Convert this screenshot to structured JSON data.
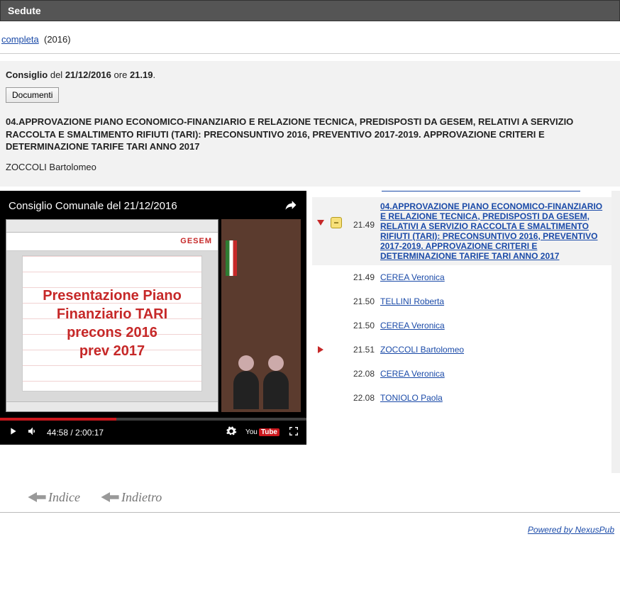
{
  "header": {
    "title": "Sedute"
  },
  "breadcrumb": {
    "link": "completa",
    "year": "(2016)"
  },
  "session": {
    "prefix": "Consiglio",
    "del": "del",
    "date": "21/12/2016",
    "ore": "ore",
    "time": "21.19",
    "suffix": "."
  },
  "documenti_btn": "Documenti",
  "agenda_title": "04.APPROVAZIONE PIANO ECONOMICO-FINANZIARIO E RELAZIONE TECNICA, PREDISPOSTI DA GESEM, RELATIVI A SERVIZIO RACCOLTA E SMALTIMENTO RIFIUTI (TARI): PRECONSUNTIVO 2016, PREVENTIVO 2017-2019. APPROVAZIONE CRITERI E DETERMINAZIONE TARIFE TARI ANNO 2017",
  "speaker_main": "ZOCCOLI Bartolomeo",
  "video": {
    "title": "Consiglio Comunale del 21/12/2016",
    "slide_brand": "GESEM",
    "slide_line1": "Presentazione Piano",
    "slide_line2": "Finanziario TARI",
    "slide_line3": "precons 2016",
    "slide_line4": "prev 2017",
    "time_current": "44:58",
    "time_sep": " / ",
    "time_total": "2:00:17",
    "youtube_you": "You",
    "youtube_tube": "Tube"
  },
  "agenda_items": [
    {
      "time": "21.49",
      "text": "04.APPROVAZIONE PIANO ECONOMICO-FINANZIARIO E RELAZIONE TECNICA, PREDISPOSTI DA GESEM, RELATIVI A SERVIZIO RACCOLTA E SMALTIMENTO RIFIUTI (TARI): PRECONSUNTIVO 2016, PREVENTIVO 2017-2019. APPROVAZIONE CRITERI E DETERMINAZIONE TARIFE TARI ANNO 2017",
      "highlight": true,
      "arrow": "down",
      "collapse": "−"
    },
    {
      "time": "21.49",
      "text": "CEREA Veronica"
    },
    {
      "time": "21.50",
      "text": "TELLINI Roberta"
    },
    {
      "time": "21.50",
      "text": "CEREA Veronica"
    },
    {
      "time": "21.51",
      "text": "ZOCCOLI Bartolomeo",
      "arrow": "right"
    },
    {
      "time": "22.08",
      "text": "CEREA Veronica"
    },
    {
      "time": "22.08",
      "text": "TONIOLO Paola"
    }
  ],
  "nav": {
    "indice": "Indice",
    "indietro": "Indietro"
  },
  "powered": "Powered by NexusPub"
}
